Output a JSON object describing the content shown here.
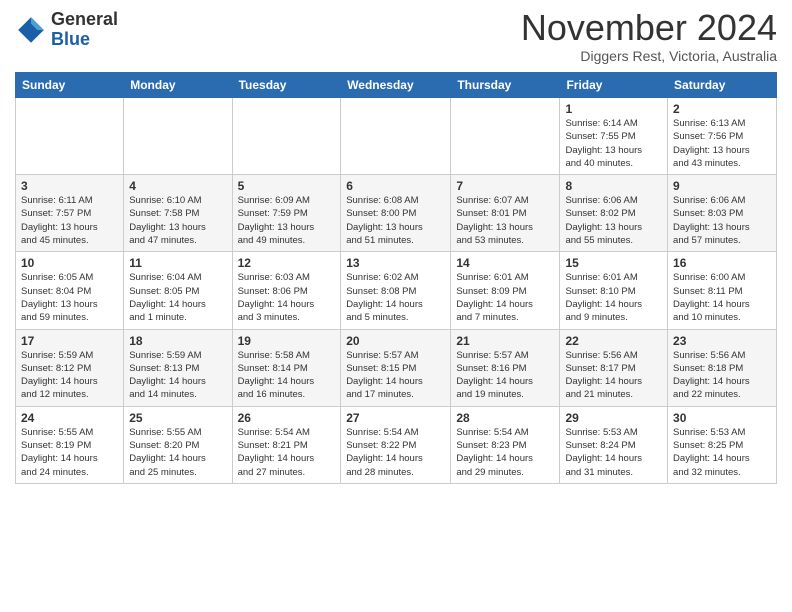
{
  "header": {
    "logo_general": "General",
    "logo_blue": "Blue",
    "month": "November 2024",
    "location": "Diggers Rest, Victoria, Australia"
  },
  "weekdays": [
    "Sunday",
    "Monday",
    "Tuesday",
    "Wednesday",
    "Thursday",
    "Friday",
    "Saturday"
  ],
  "weeks": [
    [
      {
        "day": "",
        "info": ""
      },
      {
        "day": "",
        "info": ""
      },
      {
        "day": "",
        "info": ""
      },
      {
        "day": "",
        "info": ""
      },
      {
        "day": "",
        "info": ""
      },
      {
        "day": "1",
        "info": "Sunrise: 6:14 AM\nSunset: 7:55 PM\nDaylight: 13 hours\nand 40 minutes."
      },
      {
        "day": "2",
        "info": "Sunrise: 6:13 AM\nSunset: 7:56 PM\nDaylight: 13 hours\nand 43 minutes."
      }
    ],
    [
      {
        "day": "3",
        "info": "Sunrise: 6:11 AM\nSunset: 7:57 PM\nDaylight: 13 hours\nand 45 minutes."
      },
      {
        "day": "4",
        "info": "Sunrise: 6:10 AM\nSunset: 7:58 PM\nDaylight: 13 hours\nand 47 minutes."
      },
      {
        "day": "5",
        "info": "Sunrise: 6:09 AM\nSunset: 7:59 PM\nDaylight: 13 hours\nand 49 minutes."
      },
      {
        "day": "6",
        "info": "Sunrise: 6:08 AM\nSunset: 8:00 PM\nDaylight: 13 hours\nand 51 minutes."
      },
      {
        "day": "7",
        "info": "Sunrise: 6:07 AM\nSunset: 8:01 PM\nDaylight: 13 hours\nand 53 minutes."
      },
      {
        "day": "8",
        "info": "Sunrise: 6:06 AM\nSunset: 8:02 PM\nDaylight: 13 hours\nand 55 minutes."
      },
      {
        "day": "9",
        "info": "Sunrise: 6:06 AM\nSunset: 8:03 PM\nDaylight: 13 hours\nand 57 minutes."
      }
    ],
    [
      {
        "day": "10",
        "info": "Sunrise: 6:05 AM\nSunset: 8:04 PM\nDaylight: 13 hours\nand 59 minutes."
      },
      {
        "day": "11",
        "info": "Sunrise: 6:04 AM\nSunset: 8:05 PM\nDaylight: 14 hours\nand 1 minute."
      },
      {
        "day": "12",
        "info": "Sunrise: 6:03 AM\nSunset: 8:06 PM\nDaylight: 14 hours\nand 3 minutes."
      },
      {
        "day": "13",
        "info": "Sunrise: 6:02 AM\nSunset: 8:08 PM\nDaylight: 14 hours\nand 5 minutes."
      },
      {
        "day": "14",
        "info": "Sunrise: 6:01 AM\nSunset: 8:09 PM\nDaylight: 14 hours\nand 7 minutes."
      },
      {
        "day": "15",
        "info": "Sunrise: 6:01 AM\nSunset: 8:10 PM\nDaylight: 14 hours\nand 9 minutes."
      },
      {
        "day": "16",
        "info": "Sunrise: 6:00 AM\nSunset: 8:11 PM\nDaylight: 14 hours\nand 10 minutes."
      }
    ],
    [
      {
        "day": "17",
        "info": "Sunrise: 5:59 AM\nSunset: 8:12 PM\nDaylight: 14 hours\nand 12 minutes."
      },
      {
        "day": "18",
        "info": "Sunrise: 5:59 AM\nSunset: 8:13 PM\nDaylight: 14 hours\nand 14 minutes."
      },
      {
        "day": "19",
        "info": "Sunrise: 5:58 AM\nSunset: 8:14 PM\nDaylight: 14 hours\nand 16 minutes."
      },
      {
        "day": "20",
        "info": "Sunrise: 5:57 AM\nSunset: 8:15 PM\nDaylight: 14 hours\nand 17 minutes."
      },
      {
        "day": "21",
        "info": "Sunrise: 5:57 AM\nSunset: 8:16 PM\nDaylight: 14 hours\nand 19 minutes."
      },
      {
        "day": "22",
        "info": "Sunrise: 5:56 AM\nSunset: 8:17 PM\nDaylight: 14 hours\nand 21 minutes."
      },
      {
        "day": "23",
        "info": "Sunrise: 5:56 AM\nSunset: 8:18 PM\nDaylight: 14 hours\nand 22 minutes."
      }
    ],
    [
      {
        "day": "24",
        "info": "Sunrise: 5:55 AM\nSunset: 8:19 PM\nDaylight: 14 hours\nand 24 minutes."
      },
      {
        "day": "25",
        "info": "Sunrise: 5:55 AM\nSunset: 8:20 PM\nDaylight: 14 hours\nand 25 minutes."
      },
      {
        "day": "26",
        "info": "Sunrise: 5:54 AM\nSunset: 8:21 PM\nDaylight: 14 hours\nand 27 minutes."
      },
      {
        "day": "27",
        "info": "Sunrise: 5:54 AM\nSunset: 8:22 PM\nDaylight: 14 hours\nand 28 minutes."
      },
      {
        "day": "28",
        "info": "Sunrise: 5:54 AM\nSunset: 8:23 PM\nDaylight: 14 hours\nand 29 minutes."
      },
      {
        "day": "29",
        "info": "Sunrise: 5:53 AM\nSunset: 8:24 PM\nDaylight: 14 hours\nand 31 minutes."
      },
      {
        "day": "30",
        "info": "Sunrise: 5:53 AM\nSunset: 8:25 PM\nDaylight: 14 hours\nand 32 minutes."
      }
    ]
  ]
}
